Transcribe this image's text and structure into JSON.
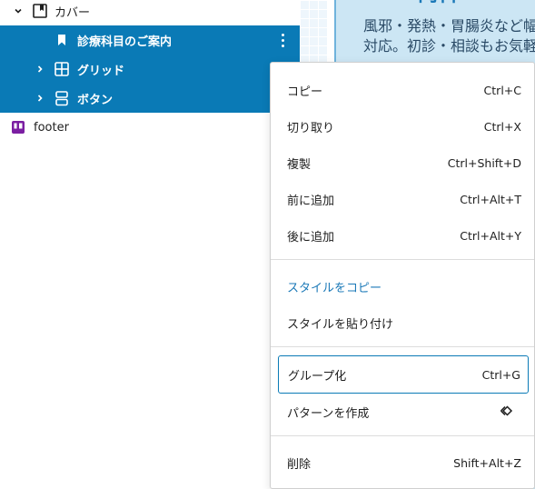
{
  "list": {
    "rows": [
      {
        "label": "カバー",
        "icon": "cover-block-icon",
        "expanded": true
      },
      {
        "label": "診療科目のご案内",
        "icon": "bookmark-icon",
        "selected": true
      },
      {
        "label": "グリッド",
        "icon": "grid-block-icon",
        "selected": true
      },
      {
        "label": "ボタン",
        "icon": "buttons-block-icon",
        "selected": true
      },
      {
        "label": "footer",
        "icon": "template-part-icon"
      }
    ]
  },
  "canvas": {
    "title": "内科",
    "line1": "風邪・発熱・胃腸炎など幅",
    "line2": "対応。初診・相談もお気軽"
  },
  "menu": {
    "groups": [
      [
        {
          "label": "コピー",
          "shortcut": "Ctrl+C"
        },
        {
          "label": "切り取り",
          "shortcut": "Ctrl+X"
        },
        {
          "label": "複製",
          "shortcut": "Ctrl+Shift+D"
        },
        {
          "label": "前に追加",
          "shortcut": "Ctrl+Alt+T"
        },
        {
          "label": "後に追加",
          "shortcut": "Ctrl+Alt+Y"
        }
      ],
      [
        {
          "label": "スタイルをコピー",
          "shortcut": ""
        },
        {
          "label": "スタイルを貼り付け",
          "shortcut": ""
        }
      ],
      [
        {
          "label": "グループ化",
          "shortcut": "Ctrl+G"
        },
        {
          "label": "パターンを作成",
          "shortcut": "",
          "icon": "diamond-pattern-icon"
        }
      ],
      [
        {
          "label": "削除",
          "shortcut": "Shift+Alt+Z"
        }
      ]
    ]
  },
  "colors": {
    "selection": "#0a7ab6",
    "accent": "#1b79b8",
    "footer_icon": "#7b1fa2"
  }
}
